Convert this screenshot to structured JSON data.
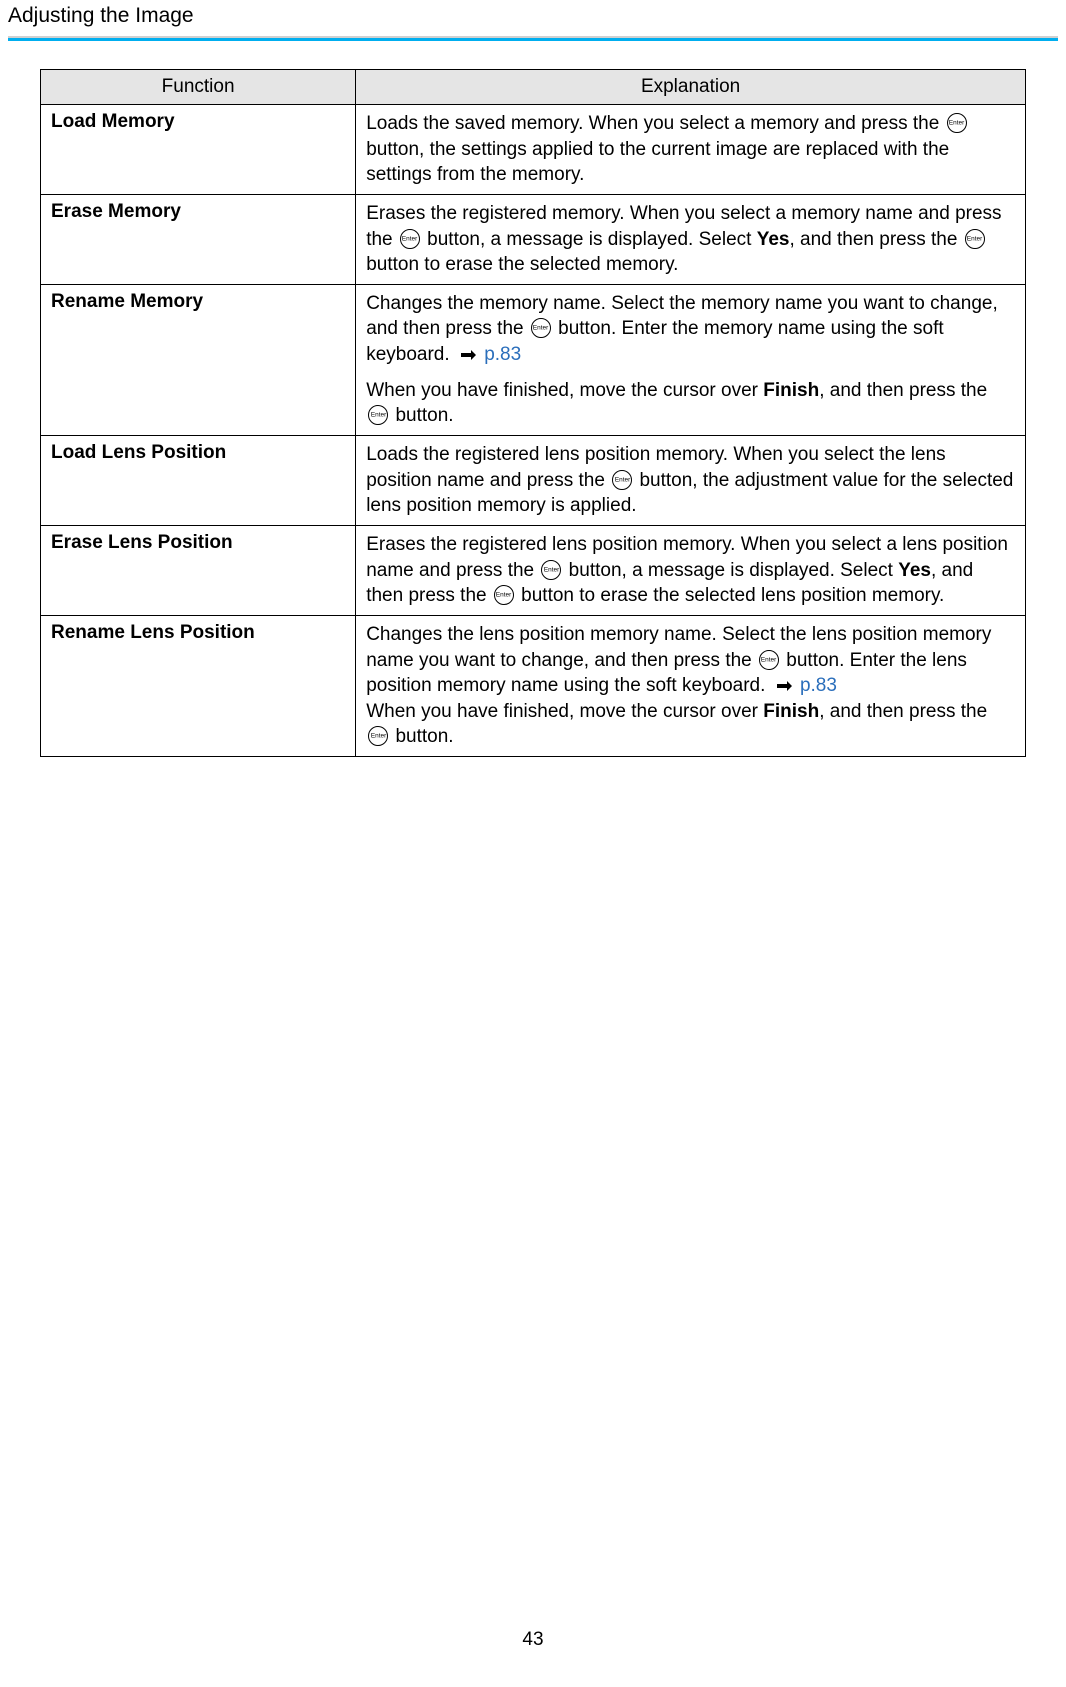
{
  "header": {
    "title": "Adjusting the Image"
  },
  "table": {
    "headers": {
      "function": "Function",
      "explanation": "Explanation"
    },
    "rows": {
      "loadMemory": {
        "name": "Load Memory",
        "t1": "Loads the saved memory. When you select a memory and press the ",
        "t2": " button, the settings applied to the current image are replaced with the settings from the memory."
      },
      "eraseMemory": {
        "name": "Erase Memory",
        "t1": "Erases the registered memory. When you select a memory name and press the ",
        "t2": " button, a message is displayed. Select ",
        "yes": "Yes",
        "t3": ", and then press the ",
        "t4": " button to erase the selected memory."
      },
      "renameMemory": {
        "name": "Rename Memory",
        "t1": "Changes the memory name. Select the memory name you want to change, and then press the ",
        "t2": " button. Enter the memory name using the soft keyboard. ",
        "ref": "p.83",
        "t3": "When you have finished, move the cursor over ",
        "finish": "Finish",
        "t4": ", and then press the ",
        "t5": " button."
      },
      "loadLens": {
        "name": "Load Lens Position",
        "t1": "Loads the registered lens position memory. When you select the lens position name and press the ",
        "t2": " button, the adjustment value for the selected lens position memory is applied."
      },
      "eraseLens": {
        "name": "Erase Lens Position",
        "t1": "Erases the registered lens position memory. When you select a lens position name and press the ",
        "t2": " button, a message is displayed. Select ",
        "yes": "Yes",
        "t3": ", and then press the ",
        "t4": " button to erase the selected lens position memory."
      },
      "renameLens": {
        "name": "Rename Lens Position",
        "t1": "Changes the lens position memory name. Select the lens position memory name you want to change, and then press the ",
        "t2": " button. Enter the lens position memory name using the soft keyboard. ",
        "ref": "p.83",
        "t3": "When you have finished, move the cursor over ",
        "finish": "Finish",
        "t4": ", and then press the ",
        "t5": " button."
      }
    }
  },
  "pageNumber": "43"
}
